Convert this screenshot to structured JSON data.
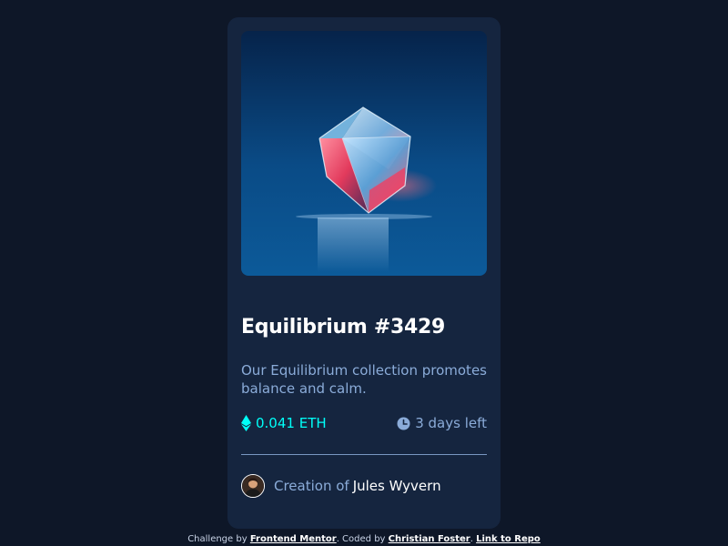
{
  "card": {
    "image": {
      "icon": "equilibrium-cube-image"
    },
    "title": "Equilibrium #3429",
    "description": "Our Equilibrium collection promotes balance and calm.",
    "price": {
      "icon": "ethereum-icon",
      "value": "0.041 ETH"
    },
    "time_left": {
      "icon": "clock-icon",
      "value": "3 days left"
    },
    "creator": {
      "prefix": "Creation of",
      "name": "Jules Wyvern",
      "avatar_icon": "avatar"
    }
  },
  "attribution": {
    "challenge_text": "Challenge by",
    "challenge_link": "Frontend Mentor",
    "coded_text": ". Coded by",
    "coded_link": "Christian Foster",
    "sep": ".",
    "repo_link": "Link to Repo"
  },
  "colors": {
    "background": "#0e1728",
    "card": "#15253f",
    "accent_cyan": "#00fff8",
    "soft_blue": "#8bacd9",
    "white": "#ffffff"
  }
}
